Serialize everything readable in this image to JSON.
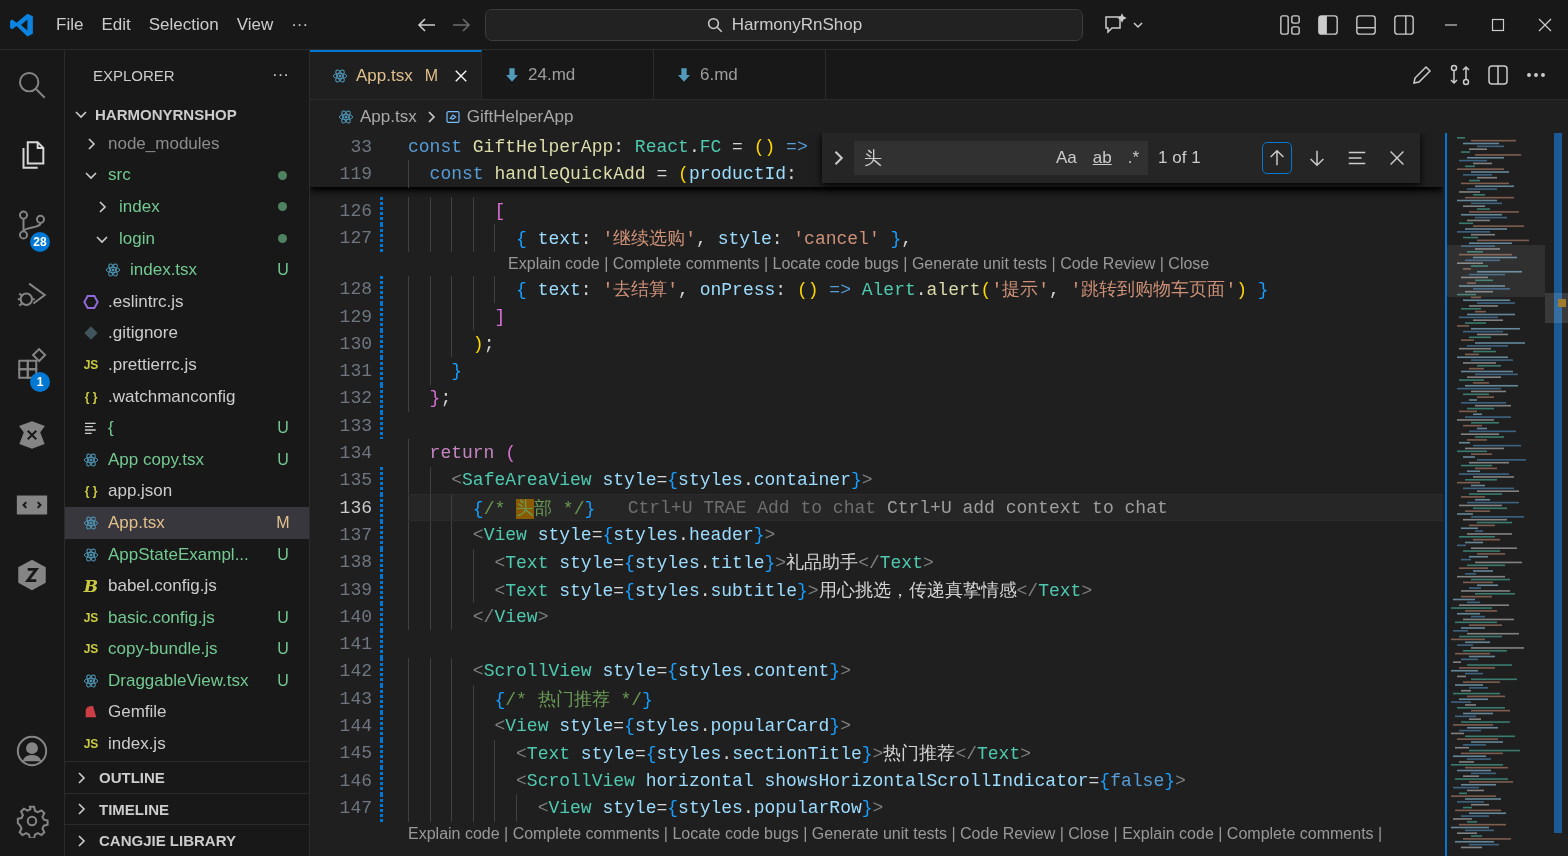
{
  "title_bar": {
    "menus": [
      "File",
      "Edit",
      "Selection",
      "View",
      "···"
    ],
    "nav": [
      {
        "kind": "back",
        "disabled": false
      },
      {
        "kind": "forward",
        "disabled": true
      }
    ],
    "command_center": "HarmonyRnShop"
  },
  "activity_bar": [
    {
      "kind": "search",
      "selected": false
    },
    {
      "kind": "explorer",
      "selected": true
    },
    {
      "kind": "scm",
      "selected": false,
      "badge": "28"
    },
    {
      "kind": "debug",
      "selected": false
    },
    {
      "kind": "extensions",
      "selected": false,
      "badge": "1"
    },
    {
      "kind": "spark",
      "selected": false
    },
    {
      "kind": "remote",
      "selected": false
    },
    {
      "kind": "cube",
      "selected": false
    },
    {
      "kind": "account",
      "selected": false
    },
    {
      "kind": "settings",
      "selected": false
    }
  ],
  "sidebar": {
    "title": "EXPLORER",
    "more": "···",
    "root": {
      "label": "HARMONYRNSHOP",
      "expanded": true,
      "children": [
        {
          "label": "node_modules",
          "kind": "folder",
          "expanded": false,
          "color": "#8c8c8c",
          "dot": false,
          "selected": false
        },
        {
          "label": "src",
          "kind": "folder",
          "expanded": true,
          "color": "#73c991",
          "dot": true,
          "selected": false,
          "children": [
            {
              "label": "index",
              "kind": "folder",
              "expanded": false,
              "color": "#73c991",
              "dot": true,
              "selected": false
            },
            {
              "label": "login",
              "kind": "folder",
              "expanded": true,
              "color": "#73c991",
              "dot": true,
              "selected": false,
              "children": [
                {
                  "label": "index.tsx",
                  "kind": "react",
                  "color": "#73c991",
                  "badge": "U",
                  "selected": false
                }
              ]
            }
          ]
        },
        {
          "label": ".eslintrc.js",
          "kind": "eslint",
          "color": "#cccccc",
          "selected": false
        },
        {
          "label": ".gitignore",
          "kind": "git",
          "color": "#cccccc",
          "selected": false
        },
        {
          "label": ".prettierrc.js",
          "kind": "js",
          "glyph": "JS",
          "color": "#cccccc",
          "selected": false
        },
        {
          "label": ".watchmanconfig",
          "kind": "json",
          "glyph": "{ }",
          "color": "#cccccc",
          "selected": false
        },
        {
          "label": "{",
          "kind": "lines",
          "color": "#73c991",
          "badge": "U",
          "selected": false
        },
        {
          "label": "App copy.tsx",
          "kind": "react",
          "color": "#73c991",
          "badge": "U",
          "selected": false
        },
        {
          "label": "app.json",
          "kind": "json",
          "glyph": "{ }",
          "color": "#cccccc",
          "selected": false
        },
        {
          "label": "App.tsx",
          "kind": "react",
          "color": "#e2c08d",
          "badge": "M",
          "selected": true
        },
        {
          "label": "AppStateExampl...",
          "kind": "react",
          "color": "#73c991",
          "badge": "U",
          "selected": false
        },
        {
          "label": "babel.config.js",
          "kind": "babel",
          "glyph": "B",
          "color": "#cccccc",
          "selected": false
        },
        {
          "label": "basic.config.js",
          "kind": "js",
          "glyph": "JS",
          "color": "#73c991",
          "badge": "U",
          "selected": false
        },
        {
          "label": "copy-bundle.js",
          "kind": "js",
          "glyph": "JS",
          "color": "#73c991",
          "badge": "U",
          "selected": false
        },
        {
          "label": "DraggableView.tsx",
          "kind": "react",
          "color": "#73c991",
          "badge": "U",
          "selected": false
        },
        {
          "label": "Gemfile",
          "kind": "ruby",
          "color": "#cccccc",
          "selected": false
        },
        {
          "label": "index.js",
          "kind": "js",
          "glyph": "JS",
          "color": "#cccccc",
          "selected": false
        }
      ]
    },
    "sections": [
      {
        "label": "OUTLINE",
        "expanded": false
      },
      {
        "label": "TIMELINE",
        "expanded": false
      },
      {
        "label": "CANGJIE LIBRARY",
        "expanded": false
      }
    ]
  },
  "tabs": [
    {
      "label": "App.tsx",
      "kind": "react",
      "color": "#e2c08d",
      "badge": "M",
      "selected": true
    },
    {
      "label": "24.md",
      "kind": "markdown",
      "color": "#9d9d9d",
      "selected": false
    },
    {
      "label": "6.md",
      "kind": "markdown",
      "color": "#9d9d9d",
      "selected": false
    }
  ],
  "breadcrumb": [
    {
      "label": "App.tsx",
      "kind": "react"
    },
    {
      "label": "GiftHelperApp",
      "kind": "symbol"
    }
  ],
  "editor": {
    "sticky": [
      {
        "n": "33",
        "tokens": [
          {
            "kind": "keyword",
            "text": "const "
          },
          {
            "kind": "function",
            "text": "GiftHelperApp"
          },
          {
            "kind": "plain",
            "text": ": "
          },
          {
            "kind": "type",
            "text": "React"
          },
          {
            "kind": "plain",
            "text": "."
          },
          {
            "kind": "type",
            "text": "FC"
          },
          {
            "kind": "plain",
            "text": " = "
          },
          {
            "kind": "bracket1",
            "text": "() "
          },
          {
            "kind": "keyword",
            "text": "=>"
          }
        ]
      },
      {
        "n": "119",
        "tokens": [
          {
            "kind": "keyword",
            "text": "  const "
          },
          {
            "kind": "function",
            "text": "handleQuickAdd"
          },
          {
            "kind": "plain",
            "text": " = "
          },
          {
            "kind": "bracket1",
            "text": "("
          },
          {
            "kind": "variable",
            "text": "productId"
          },
          {
            "kind": "plain",
            "text": ":"
          }
        ]
      }
    ],
    "lines": [
      {
        "kind": "code",
        "n": "126",
        "changed": true,
        "current": false,
        "tokens": [
          {
            "kind": "bracket2",
            "text": "        ["
          }
        ]
      },
      {
        "kind": "code",
        "n": "127",
        "changed": true,
        "current": false,
        "tokens": [
          {
            "kind": "bracket3",
            "text": "          { "
          },
          {
            "kind": "variable",
            "text": "text"
          },
          {
            "kind": "plain",
            "text": ": "
          },
          {
            "kind": "string",
            "text": "'继续选购'"
          },
          {
            "kind": "plain",
            "text": ", "
          },
          {
            "kind": "variable",
            "text": "style"
          },
          {
            "kind": "plain",
            "text": ": "
          },
          {
            "kind": "string",
            "text": "'cancel' "
          },
          {
            "kind": "bracket3",
            "text": "}"
          },
          {
            "kind": "plain",
            "text": ","
          }
        ]
      },
      {
        "kind": "lens",
        "text": "Explain code | Complete comments | Locate code bugs | Generate unit tests | Code Review | Close"
      },
      {
        "kind": "code",
        "n": "128",
        "changed": true,
        "current": false,
        "tokens": [
          {
            "kind": "bracket3",
            "text": "          { "
          },
          {
            "kind": "variable",
            "text": "text"
          },
          {
            "kind": "plain",
            "text": ": "
          },
          {
            "kind": "string",
            "text": "'去结算'"
          },
          {
            "kind": "plain",
            "text": ", "
          },
          {
            "kind": "variable",
            "text": "onPress"
          },
          {
            "kind": "plain",
            "text": ": "
          },
          {
            "kind": "bracket1",
            "text": "() "
          },
          {
            "kind": "keyword",
            "text": "=> "
          },
          {
            "kind": "type",
            "text": "Alert"
          },
          {
            "kind": "plain",
            "text": "."
          },
          {
            "kind": "function",
            "text": "alert"
          },
          {
            "kind": "bracket1",
            "text": "("
          },
          {
            "kind": "string",
            "text": "'提示'"
          },
          {
            "kind": "plain",
            "text": ", "
          },
          {
            "kind": "string",
            "text": "'跳转到购物车页面'"
          },
          {
            "kind": "bracket1",
            "text": ") "
          },
          {
            "kind": "bracket3",
            "text": "}"
          }
        ]
      },
      {
        "kind": "code",
        "n": "129",
        "changed": true,
        "current": false,
        "tokens": [
          {
            "kind": "bracket2",
            "text": "        ]"
          }
        ]
      },
      {
        "kind": "code",
        "n": "130",
        "changed": true,
        "current": false,
        "tokens": [
          {
            "kind": "bracket1",
            "text": "      )"
          },
          {
            "kind": "plain",
            "text": ";"
          }
        ]
      },
      {
        "kind": "code",
        "n": "131",
        "changed": true,
        "current": false,
        "tokens": [
          {
            "kind": "bracket3",
            "text": "    }"
          }
        ]
      },
      {
        "kind": "code",
        "n": "132",
        "changed": true,
        "current": false,
        "tokens": [
          {
            "kind": "bracket2",
            "text": "  }"
          },
          {
            "kind": "plain",
            "text": ";"
          }
        ]
      },
      {
        "kind": "code",
        "n": "133",
        "changed": true,
        "current": false
      },
      {
        "kind": "code",
        "n": "134",
        "changed": false,
        "current": false,
        "tokens": [
          {
            "kind": "control",
            "text": "  return "
          },
          {
            "kind": "bracket2",
            "text": "("
          }
        ]
      },
      {
        "kind": "code",
        "n": "135",
        "changed": true,
        "current": false,
        "tokens": [
          {
            "kind": "punct",
            "text": "    <"
          },
          {
            "kind": "type",
            "text": "SafeAreaView "
          },
          {
            "kind": "variable",
            "text": "style"
          },
          {
            "kind": "plain",
            "text": "="
          },
          {
            "kind": "bracket3",
            "text": "{"
          },
          {
            "kind": "variable",
            "text": "styles"
          },
          {
            "kind": "plain",
            "text": "."
          },
          {
            "kind": "variable",
            "text": "container"
          },
          {
            "kind": "bracket3",
            "text": "}"
          },
          {
            "kind": "punct",
            "text": ">"
          }
        ]
      },
      {
        "kind": "code",
        "n": "136",
        "changed": true,
        "current": true,
        "tokens": [
          {
            "kind": "bracket3",
            "text": "      {"
          },
          {
            "kind": "comment",
            "text": "/* "
          },
          {
            "kind": "match",
            "text": "头"
          },
          {
            "kind": "comment",
            "text": "部 */"
          },
          {
            "kind": "bracket3",
            "text": "}"
          }
        ],
        "hints": [
          "Ctrl+U TRAE Add to chat",
          "Ctrl+U add context to chat"
        ]
      },
      {
        "kind": "code",
        "n": "137",
        "changed": true,
        "current": false,
        "tokens": [
          {
            "kind": "punct",
            "text": "      <"
          },
          {
            "kind": "type",
            "text": "View "
          },
          {
            "kind": "variable",
            "text": "style"
          },
          {
            "kind": "plain",
            "text": "="
          },
          {
            "kind": "bracket3",
            "text": "{"
          },
          {
            "kind": "variable",
            "text": "styles"
          },
          {
            "kind": "plain",
            "text": "."
          },
          {
            "kind": "variable",
            "text": "header"
          },
          {
            "kind": "bracket3",
            "text": "}"
          },
          {
            "kind": "punct",
            "text": ">"
          }
        ]
      },
      {
        "kind": "code",
        "n": "138",
        "changed": true,
        "current": false,
        "tokens": [
          {
            "kind": "punct",
            "text": "        <"
          },
          {
            "kind": "type",
            "text": "Text "
          },
          {
            "kind": "variable",
            "text": "style"
          },
          {
            "kind": "plain",
            "text": "="
          },
          {
            "kind": "bracket3",
            "text": "{"
          },
          {
            "kind": "variable",
            "text": "styles"
          },
          {
            "kind": "plain",
            "text": "."
          },
          {
            "kind": "variable",
            "text": "title"
          },
          {
            "kind": "bracket3",
            "text": "}"
          },
          {
            "kind": "punct",
            "text": ">"
          },
          {
            "kind": "plain",
            "text": "礼品助手"
          },
          {
            "kind": "punct",
            "text": "</"
          },
          {
            "kind": "type",
            "text": "Text"
          },
          {
            "kind": "punct",
            "text": ">"
          }
        ]
      },
      {
        "kind": "code",
        "n": "139",
        "changed": true,
        "current": false,
        "tokens": [
          {
            "kind": "punct",
            "text": "        <"
          },
          {
            "kind": "type",
            "text": "Text "
          },
          {
            "kind": "variable",
            "text": "style"
          },
          {
            "kind": "plain",
            "text": "="
          },
          {
            "kind": "bracket3",
            "text": "{"
          },
          {
            "kind": "variable",
            "text": "styles"
          },
          {
            "kind": "plain",
            "text": "."
          },
          {
            "kind": "variable",
            "text": "subtitle"
          },
          {
            "kind": "bracket3",
            "text": "}"
          },
          {
            "kind": "punct",
            "text": ">"
          },
          {
            "kind": "plain",
            "text": "用心挑选，传递真挚情感"
          },
          {
            "kind": "punct",
            "text": "</"
          },
          {
            "kind": "type",
            "text": "Text"
          },
          {
            "kind": "punct",
            "text": ">"
          }
        ]
      },
      {
        "kind": "code",
        "n": "140",
        "changed": true,
        "current": false,
        "tokens": [
          {
            "kind": "punct",
            "text": "      </"
          },
          {
            "kind": "type",
            "text": "View"
          },
          {
            "kind": "punct",
            "text": ">"
          }
        ]
      },
      {
        "kind": "code",
        "n": "141",
        "changed": true,
        "current": false
      },
      {
        "kind": "code",
        "n": "142",
        "changed": true,
        "current": false,
        "tokens": [
          {
            "kind": "punct",
            "text": "      <"
          },
          {
            "kind": "type",
            "text": "ScrollView "
          },
          {
            "kind": "variable",
            "text": "style"
          },
          {
            "kind": "plain",
            "text": "="
          },
          {
            "kind": "bracket3",
            "text": "{"
          },
          {
            "kind": "variable",
            "text": "styles"
          },
          {
            "kind": "plain",
            "text": "."
          },
          {
            "kind": "variable",
            "text": "content"
          },
          {
            "kind": "bracket3",
            "text": "}"
          },
          {
            "kind": "punct",
            "text": ">"
          }
        ]
      },
      {
        "kind": "code",
        "n": "143",
        "changed": true,
        "current": false,
        "tokens": [
          {
            "kind": "bracket3",
            "text": "        {"
          },
          {
            "kind": "comment",
            "text": "/* 热门推荐 */"
          },
          {
            "kind": "bracket3",
            "text": "}"
          }
        ]
      },
      {
        "kind": "code",
        "n": "144",
        "changed": true,
        "current": false,
        "tokens": [
          {
            "kind": "punct",
            "text": "        <"
          },
          {
            "kind": "type",
            "text": "View "
          },
          {
            "kind": "variable",
            "text": "style"
          },
          {
            "kind": "plain",
            "text": "="
          },
          {
            "kind": "bracket3",
            "text": "{"
          },
          {
            "kind": "variable",
            "text": "styles"
          },
          {
            "kind": "plain",
            "text": "."
          },
          {
            "kind": "variable",
            "text": "popularCard"
          },
          {
            "kind": "bracket3",
            "text": "}"
          },
          {
            "kind": "punct",
            "text": ">"
          }
        ]
      },
      {
        "kind": "code",
        "n": "145",
        "changed": true,
        "current": false,
        "tokens": [
          {
            "kind": "punct",
            "text": "          <"
          },
          {
            "kind": "type",
            "text": "Text "
          },
          {
            "kind": "variable",
            "text": "style"
          },
          {
            "kind": "plain",
            "text": "="
          },
          {
            "kind": "bracket3",
            "text": "{"
          },
          {
            "kind": "variable",
            "text": "styles"
          },
          {
            "kind": "plain",
            "text": "."
          },
          {
            "kind": "variable",
            "text": "sectionTitle"
          },
          {
            "kind": "bracket3",
            "text": "}"
          },
          {
            "kind": "punct",
            "text": ">"
          },
          {
            "kind": "plain",
            "text": "热门推荐"
          },
          {
            "kind": "punct",
            "text": "</"
          },
          {
            "kind": "type",
            "text": "Text"
          },
          {
            "kind": "punct",
            "text": ">"
          }
        ]
      },
      {
        "kind": "code",
        "n": "146",
        "changed": true,
        "current": false,
        "tokens": [
          {
            "kind": "punct",
            "text": "          <"
          },
          {
            "kind": "type",
            "text": "ScrollView "
          },
          {
            "kind": "variable",
            "text": "horizontal showsHorizontalScrollIndicator"
          },
          {
            "kind": "plain",
            "text": "="
          },
          {
            "kind": "bracket3",
            "text": "{"
          },
          {
            "kind": "keyword",
            "text": "false"
          },
          {
            "kind": "bracket3",
            "text": "}"
          },
          {
            "kind": "punct",
            "text": ">"
          }
        ]
      },
      {
        "kind": "code",
        "n": "147",
        "changed": true,
        "current": false,
        "tokens": [
          {
            "kind": "punct",
            "text": "            <"
          },
          {
            "kind": "type",
            "text": "View "
          },
          {
            "kind": "variable",
            "text": "style"
          },
          {
            "kind": "plain",
            "text": "="
          },
          {
            "kind": "bracket3",
            "text": "{"
          },
          {
            "kind": "variable",
            "text": "styles"
          },
          {
            "kind": "plain",
            "text": "."
          },
          {
            "kind": "variable",
            "text": "popularRow"
          },
          {
            "kind": "bracket3",
            "text": "}"
          },
          {
            "kind": "punct",
            "text": ">"
          }
        ]
      },
      {
        "kind": "lens",
        "text": "Explain code | Complete comments | Locate code bugs | Generate unit tests | Code Review | Close | Explain code | Complete comments |"
      }
    ],
    "find": {
      "expanded": false,
      "query": "头",
      "toggles": [
        {
          "kind": "case",
          "label": "Aa",
          "checked": false
        },
        {
          "kind": "word",
          "label": "ab",
          "checked": false
        },
        {
          "kind": "regex",
          "label": ".*",
          "checked": false
        }
      ],
      "count": "1 of 1",
      "buttons": [
        {
          "kind": "previous",
          "focused": true
        },
        {
          "kind": "next",
          "focused": false
        },
        {
          "kind": "selection",
          "focused": false
        },
        {
          "kind": "close",
          "focused": false
        }
      ]
    }
  }
}
